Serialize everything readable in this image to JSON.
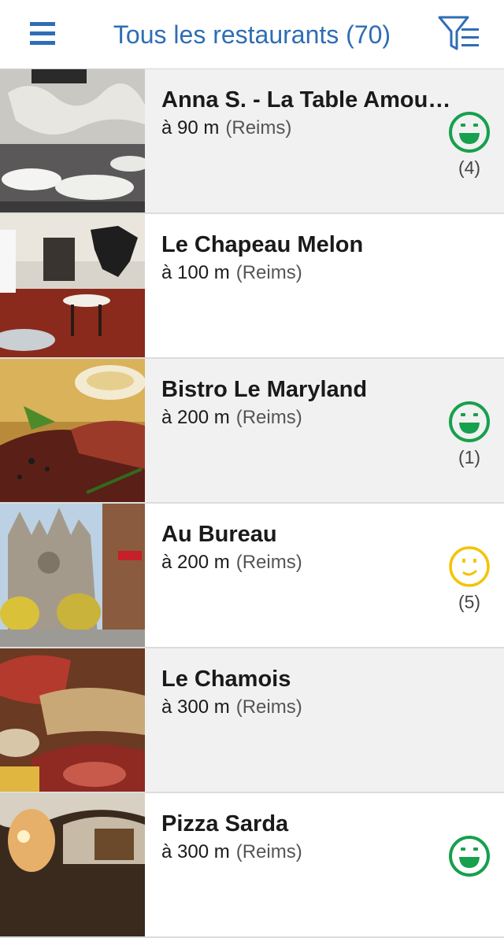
{
  "header": {
    "title": "Tous les restaurants (70)",
    "menu_icon": "hamburger-menu-icon",
    "filter_icon": "filter-list-icon"
  },
  "colors": {
    "brand_blue": "#2f6db5",
    "happy_green": "#17a04d",
    "neutral_yellow": "#f4c400"
  },
  "restaurants": [
    {
      "name": "Anna S. - La Table Amour...",
      "distance": "à 90 m",
      "city": "(Reims)",
      "rating": "happy",
      "count": "(4)"
    },
    {
      "name": "Le Chapeau Melon",
      "distance": "à 100 m",
      "city": "(Reims)",
      "rating": "",
      "count": ""
    },
    {
      "name": "Bistro Le Maryland",
      "distance": "à 200 m",
      "city": "(Reims)",
      "rating": "happy",
      "count": "(1)"
    },
    {
      "name": "Au Bureau",
      "distance": "à 200 m",
      "city": "(Reims)",
      "rating": "neutral",
      "count": "(5)"
    },
    {
      "name": "Le Chamois",
      "distance": "à 300 m",
      "city": "(Reims)",
      "rating": "",
      "count": ""
    },
    {
      "name": "Pizza Sarda",
      "distance": "à 300 m",
      "city": "(Reims)",
      "rating": "happy",
      "count": ""
    }
  ]
}
